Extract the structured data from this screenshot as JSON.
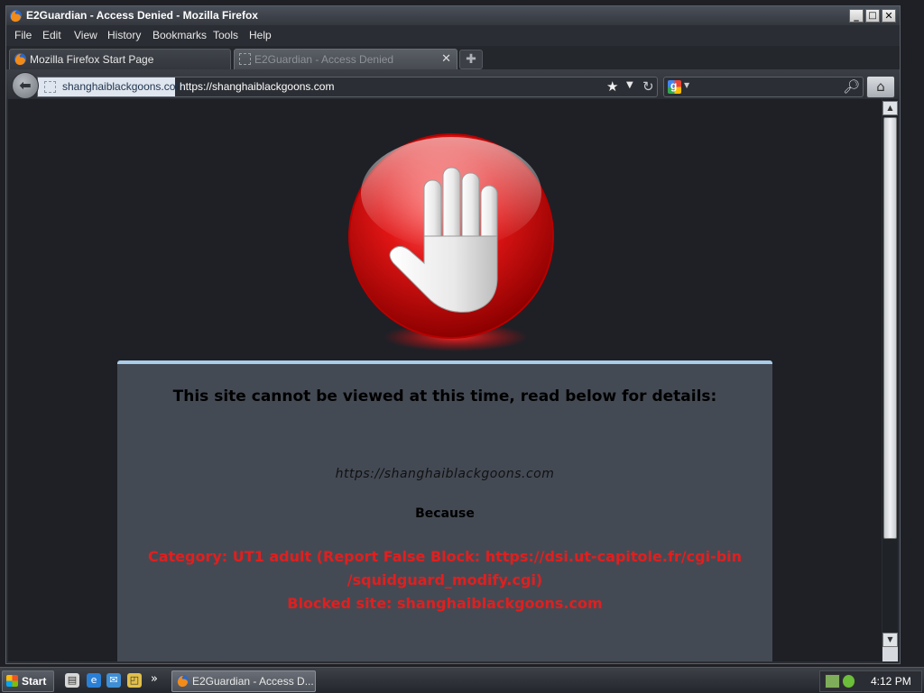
{
  "window": {
    "title": "E2Guardian - Access Denied - Mozilla Firefox",
    "buttons": {
      "minimize": "_",
      "maximize": "□",
      "close": "✕"
    }
  },
  "menubar": {
    "items": [
      "File",
      "Edit",
      "View",
      "History",
      "Bookmarks",
      "Tools",
      "Help"
    ]
  },
  "tabs": [
    {
      "label": "Mozilla Firefox Start Page",
      "active": false,
      "icon": "firefox-icon"
    },
    {
      "label": "E2Guardian - Access Denied",
      "active": true,
      "icon": "page-icon"
    }
  ],
  "tab_new_icon": "plus-icon",
  "navbar": {
    "back_icon": "back-arrow-icon",
    "identity_label": "shanghaiblackgoons.com",
    "url": "https://shanghaiblackgoons.com",
    "search_placeholder": "",
    "icons": [
      "star-icon",
      "dropdown-icon",
      "reload-icon",
      "google-icon",
      "magnifier-icon",
      "home-icon"
    ]
  },
  "page": {
    "heading": "This site cannot be viewed at this time, read below for details:",
    "blocked_url": "https://shanghaiblackgoons.com",
    "because_label": "Because",
    "reason_line1": "Category: UT1 adult (Report False Block: https://dsi.ut-capitole.fr/cgi-bin",
    "reason_line2": "/squidguard_modify.cgi)",
    "reason_line3": "Blocked site: shanghaiblackgoons.com",
    "reason_color": "#e01f1f",
    "panel_accent": "#a9cde8"
  },
  "taskbar": {
    "start_label": "Start",
    "quicklaunch_more": "»",
    "task_label": "E2Guardian - Access D...",
    "clock": "4:12 PM"
  }
}
